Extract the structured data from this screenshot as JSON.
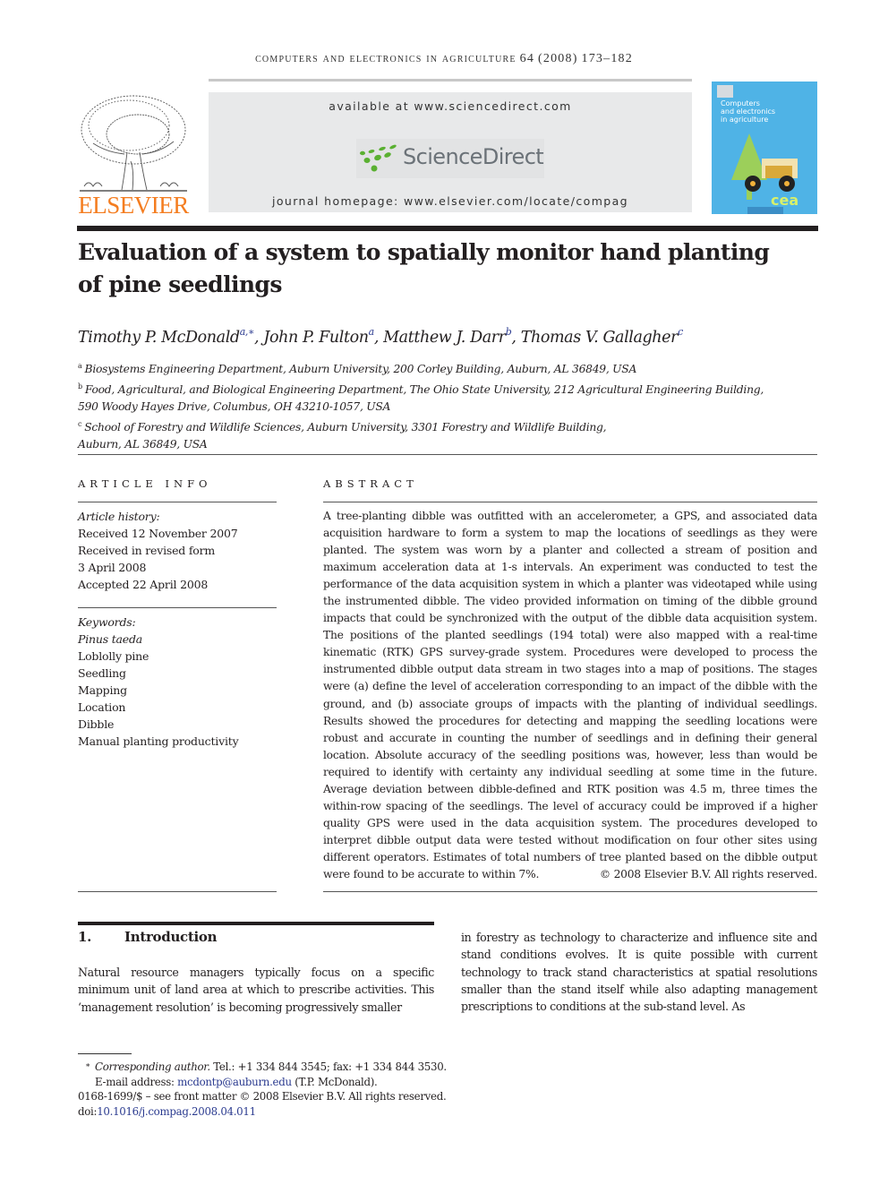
{
  "running_head": {
    "journal": "computers and electronics in agriculture",
    "volume": "64",
    "year": "(2008)",
    "pages": "173–182"
  },
  "publisher": {
    "name": "ELSEVIER",
    "color": "#f47d20"
  },
  "sciencedirect": {
    "available": "available at www.sciencedirect.com",
    "logo_text": "ScienceDirect",
    "homepage": "journal homepage: www.elsevier.com/locate/compag"
  },
  "cover": {
    "title_lines": [
      "Computers",
      "and electronics",
      "in agriculture"
    ],
    "badge": "cea",
    "color": "#4fb3e6"
  },
  "article": {
    "title_line1": "Evaluation of a system to spatially monitor hand planting",
    "title_line2": "of pine seedlings",
    "authors": [
      {
        "name": "Timothy P. McDonald",
        "sup": "a,∗"
      },
      {
        "name": "John P. Fulton",
        "sup": "a"
      },
      {
        "name": "Matthew J. Darr",
        "sup": "b"
      },
      {
        "name": "Thomas V. Gallagher",
        "sup": "c"
      }
    ],
    "affiliations": [
      {
        "label": "a",
        "lines": [
          "Biosystems Engineering Department, Auburn University, 200 Corley Building, Auburn, AL 36849, USA"
        ]
      },
      {
        "label": "b",
        "lines": [
          "Food, Agricultural, and Biological Engineering Department, The Ohio State University, 212 Agricultural Engineering Building,",
          "590 Woody Hayes Drive, Columbus, OH 43210-1057, USA"
        ]
      },
      {
        "label": "c",
        "lines": [
          "School of Forestry and Wildlife Sciences, Auburn University, 3301 Forestry and Wildlife Building,",
          "Auburn, AL 36849, USA"
        ]
      }
    ]
  },
  "article_info": {
    "heading": "ARTICLE INFO",
    "history_label": "Article history:",
    "history": [
      "Received 12 November 2007",
      "Received in revised form",
      "3 April 2008",
      "Accepted 22 April 2008"
    ],
    "keywords_label": "Keywords:",
    "keywords": [
      "Pinus taeda",
      "Loblolly pine",
      "Seedling",
      "Mapping",
      "Location",
      "Dibble",
      "Manual planting productivity"
    ]
  },
  "abstract": {
    "heading": "ABSTRACT",
    "text": "A tree-planting dibble was outfitted with an accelerometer, a GPS, and associated data acquisition hardware to form a system to map the locations of seedlings as they were planted. The system was worn by a planter and collected a stream of position and maximum acceleration data at 1-s intervals. An experiment was conducted to test the performance of the data acquisition system in which a planter was videotaped while using the instrumented dibble. The video provided information on timing of the dibble ground impacts that could be synchronized with the output of the dibble data acquisition system. The positions of the planted seedlings (194 total) were also mapped with a real-time kinematic (RTK) GPS survey-grade system. Procedures were developed to process the instrumented dibble output data stream in two stages into a map of positions. The stages were (a) define the level of acceleration corresponding to an impact of the dibble with the ground, and (b) associate groups of impacts with the planting of individual seedlings. Results showed the procedures for detecting and mapping the seedling locations were robust and accurate in counting the number of seedlings and in defining their general location. Absolute accuracy of the seedling positions was, however, less than would be required to identify with certainty any individual seedling at some time in the future. Average deviation between dibble-defined and RTK position was 4.5 m, three times the within-row spacing of the seedlings. The level of accuracy could be improved if a higher quality GPS were used in the data acquisition system. The procedures developed to interpret dibble output data were tested without modification on four other sites using different operators. Estimates of total numbers of tree planted based on the dibble output were found to be accurate to within 7%.",
    "copyright": "© 2008 Elsevier B.V. All rights reserved."
  },
  "introduction": {
    "number": "1.",
    "heading": "Introduction",
    "p1": "Natural resource managers typically focus on a specific minimum unit of land area at which to prescribe activities. This ‘management resolution’ is becoming progressively smaller",
    "p2": "in forestry as technology to characterize and influence site and stand conditions evolves. It is quite possible with current technology to track stand characteristics at spatial resolutions smaller than the stand itself while also adapting management prescriptions to conditions at the sub-stand level. As"
  },
  "footnotes": {
    "star": "∗",
    "corresponding_label": "Corresponding author.",
    "contact": " Tel.: +1 334 844 3545; fax: +1 334 844 3530.",
    "email_label": "E-mail address: ",
    "email": "mcdontp@auburn.edu",
    "email_owner": " (T.P. McDonald).",
    "front_matter": "0168-1699/$ – see front matter © 2008 Elsevier B.V. All rights reserved.",
    "doi_label": "doi:",
    "doi": "10.1016/j.compag.2008.04.011"
  }
}
